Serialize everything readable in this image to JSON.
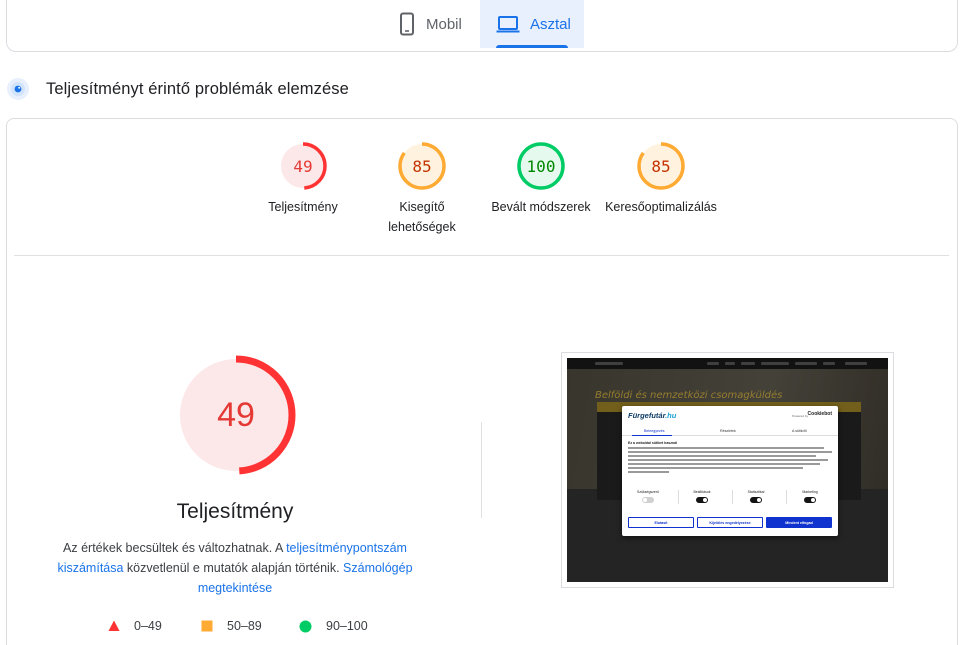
{
  "tabs": {
    "mobile_label": "Mobil",
    "desktop_label": "Asztal",
    "active": "desktop"
  },
  "section": {
    "title": "Teljesítményt érintő problémák elemzése"
  },
  "scores": [
    {
      "value": "49",
      "label_line1": "Teljesítmény",
      "label_line2": "",
      "status": "fail"
    },
    {
      "value": "85",
      "label_line1": "Kisegítő",
      "label_line2": "lehetőségek",
      "status": "average"
    },
    {
      "value": "100",
      "label_line1": "Bevált módszerek",
      "label_line2": "",
      "status": "pass"
    },
    {
      "value": "85",
      "label_line1": "Keresőoptimalizálás",
      "label_line2": "",
      "status": "average"
    }
  ],
  "main_score": {
    "value": "49",
    "title": "Teljesítmény",
    "desc_part1": "Az értékek becsültek és változhatnak. A ",
    "link1": "teljesítménypontszám kiszámítása",
    "desc_part2": " közvetlenül e mutatók alapján történik. ",
    "link2": "Számológép megtekintése"
  },
  "legend": {
    "fail_range": "0–49",
    "average_range": "50–89",
    "pass_range": "90–100"
  },
  "colors": {
    "fail": "#ff3333",
    "fail_bg": "#fce8e8",
    "average": "#ffaa33",
    "average_bg": "#fff3e0",
    "pass": "#00cc66",
    "pass_bg": "#e6f9ee",
    "accent": "#1a73e8"
  },
  "thumbnail": {
    "hero_text": "Belföldi és nemzetközi csomagküldés",
    "logo_main": "Fürgefutár",
    "logo_tld": ".hu",
    "powered_by": "Powered by",
    "consent_brand": "Cookiebot",
    "consent_tabs": [
      "Beleegyezés",
      "Részletek",
      "A sütikről"
    ],
    "consent_heading": "Ez a weboldal sütiket használ",
    "switches": [
      "Szükségszerű",
      "Beállítások",
      "Statisztikai",
      "Marketing"
    ],
    "buttons": [
      "Elutasít",
      "Kijelölés engedélyezése",
      "Mindent elfogad"
    ]
  }
}
